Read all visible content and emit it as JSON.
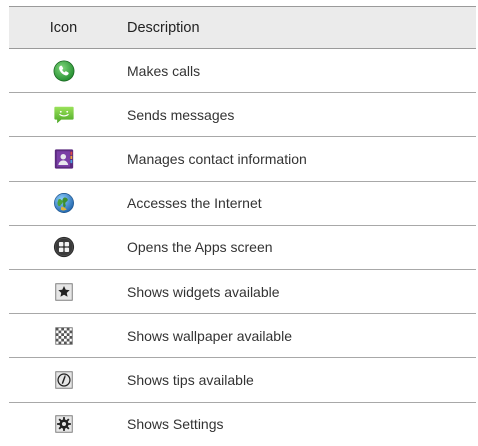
{
  "table": {
    "headers": {
      "icon": "Icon",
      "description": "Description"
    },
    "rows": [
      {
        "icon": "phone-icon",
        "description": "Makes calls"
      },
      {
        "icon": "messaging-icon",
        "description": "Sends messages"
      },
      {
        "icon": "contacts-icon",
        "description": "Manages contact information"
      },
      {
        "icon": "browser-globe-icon",
        "description": "Accesses the Internet"
      },
      {
        "icon": "apps-grid-icon",
        "description": "Opens the Apps screen"
      },
      {
        "icon": "widgets-star-icon",
        "description": "Shows widgets available"
      },
      {
        "icon": "wallpaper-checker-icon",
        "description": "Shows wallpaper available"
      },
      {
        "icon": "tips-icon",
        "description": "Shows tips available"
      },
      {
        "icon": "settings-gear-icon",
        "description": "Shows Settings"
      }
    ]
  }
}
